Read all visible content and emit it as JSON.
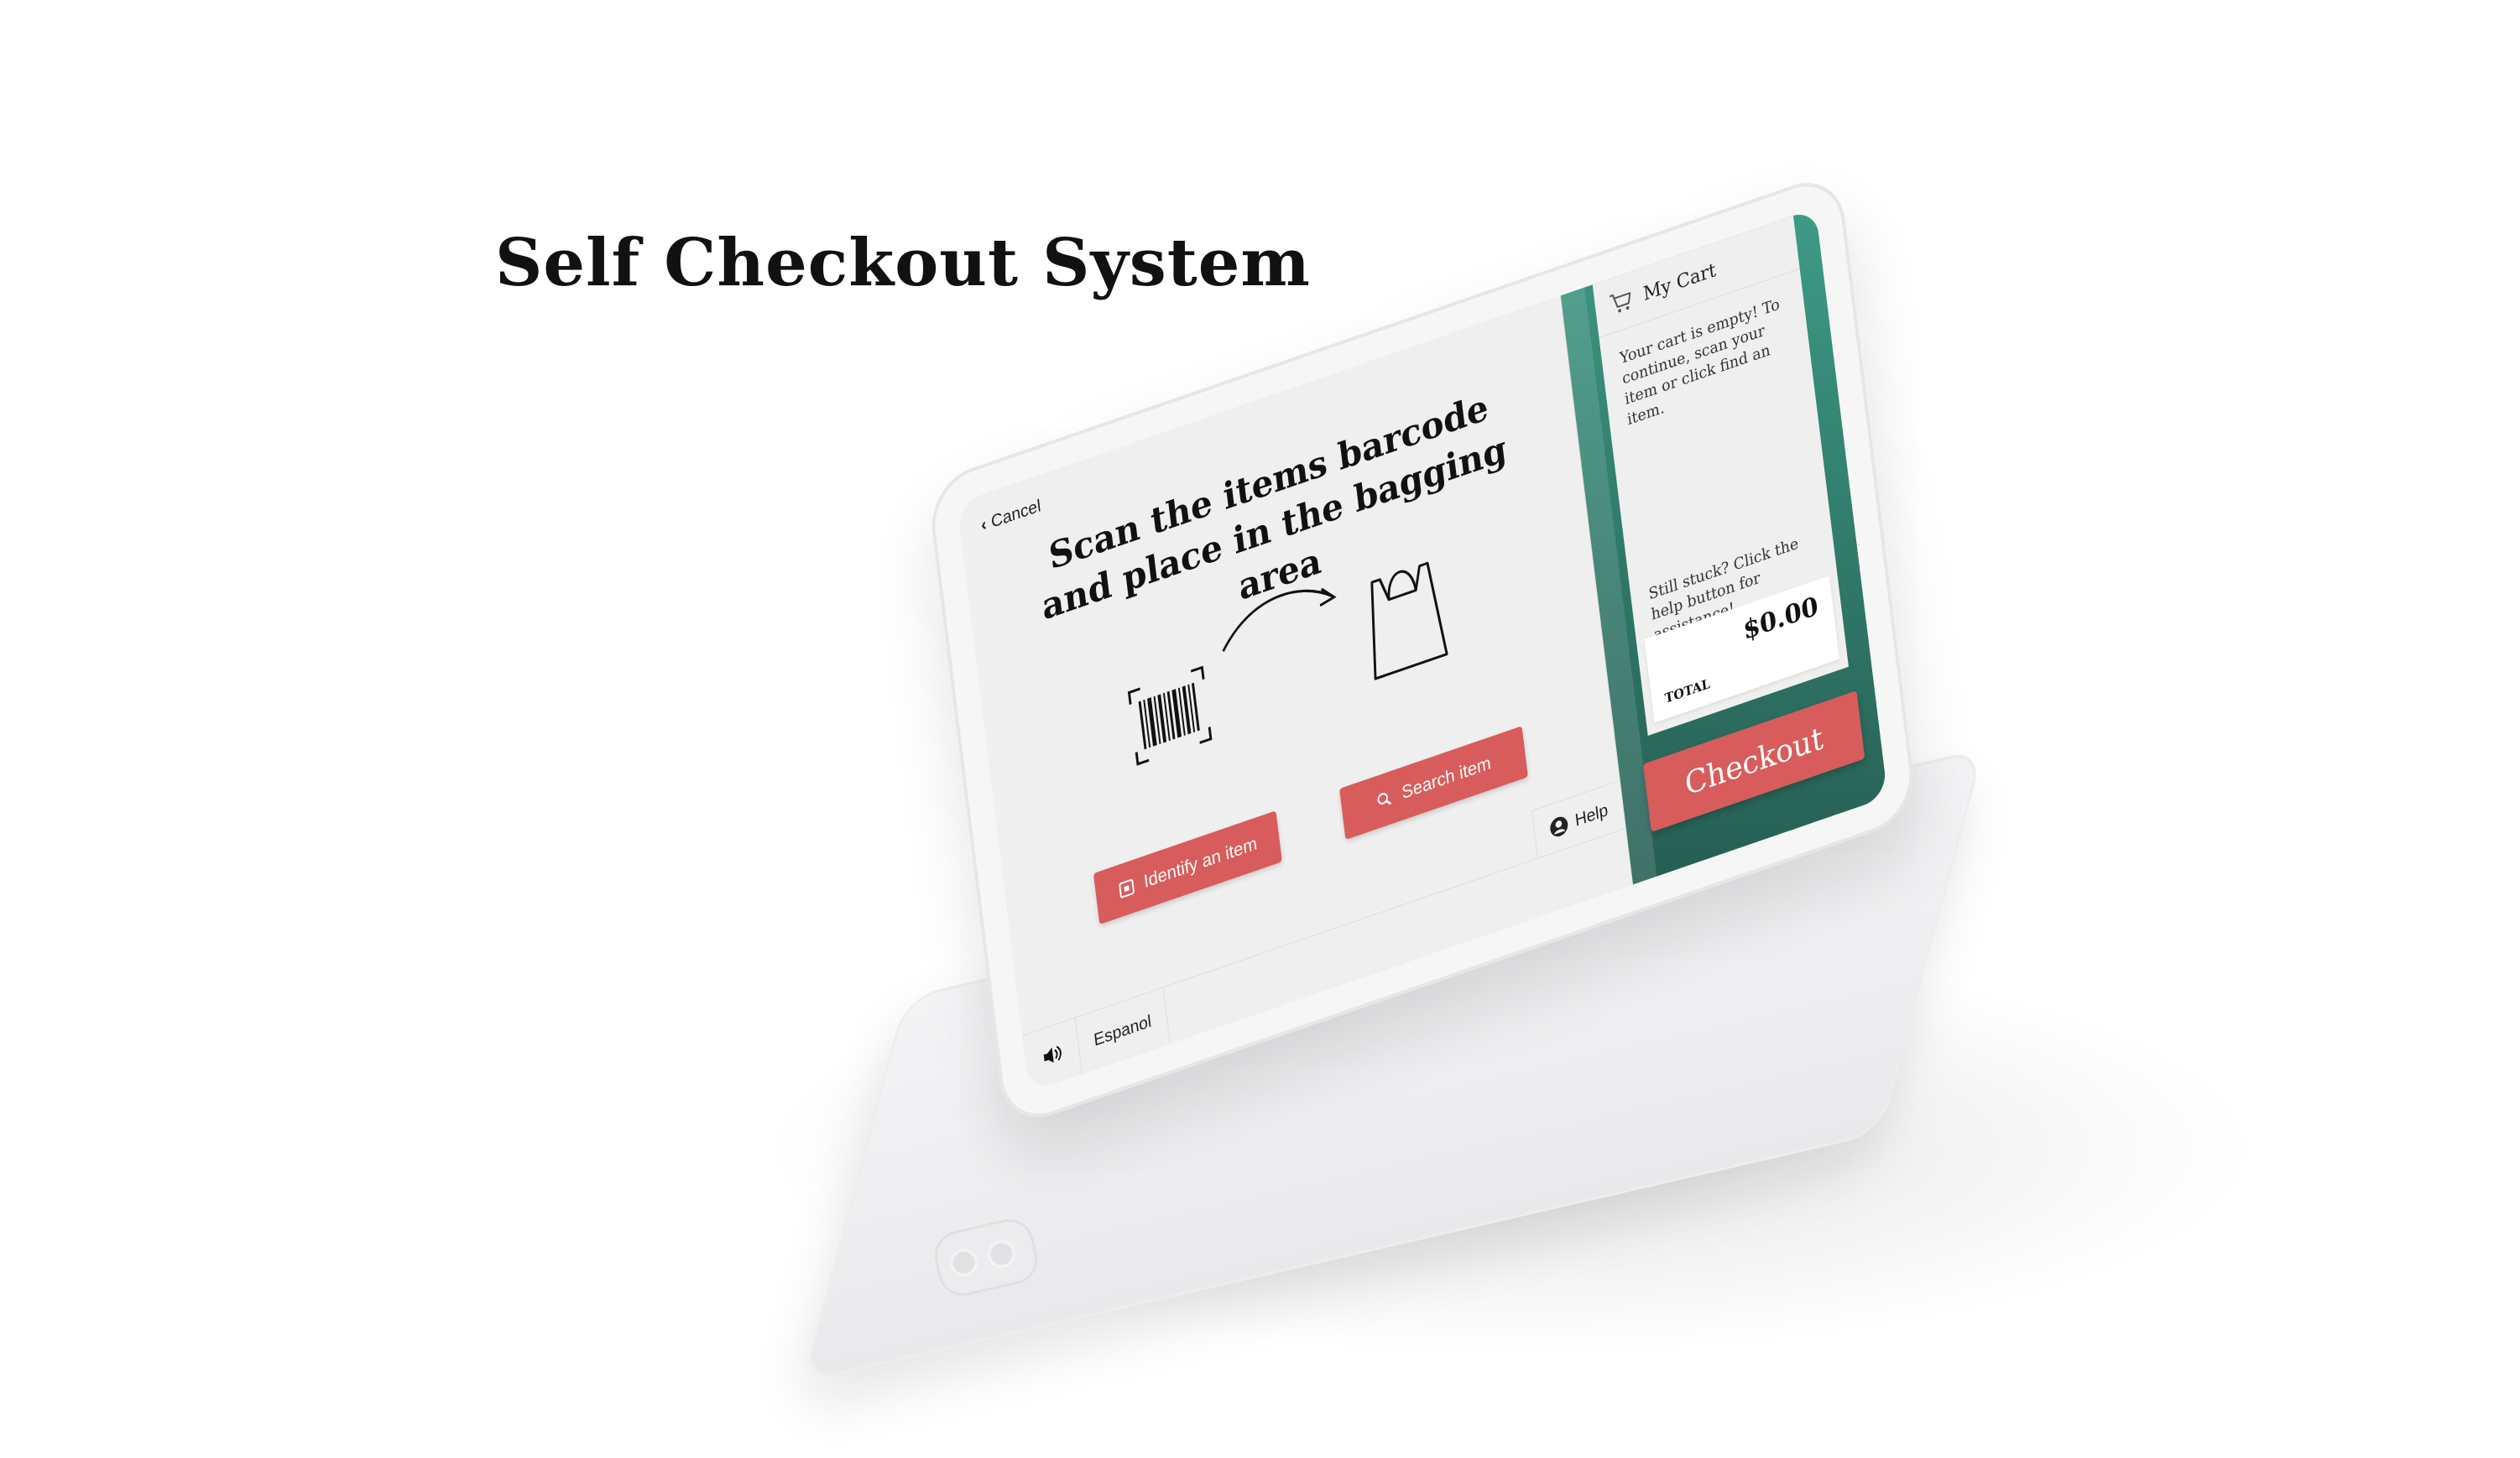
{
  "page": {
    "title": "Self Checkout System"
  },
  "scan": {
    "cancel_label": "Cancel",
    "heading_line1": "Scan the items barcode",
    "heading_line2": "and place in the bagging area",
    "identify_label": "Identify an item",
    "search_label": "Search item",
    "help_label": "Help",
    "language_label": "Espanol"
  },
  "cart": {
    "title": "My Cart",
    "empty_message": "Your cart is empty! To continue, scan your item or click find an item.",
    "stuck_message": "Still stuck? Click the help button for assistance!",
    "total_label": "TOTAL",
    "total_value": "$0.00",
    "checkout_label": "Checkout"
  },
  "icons": {
    "cancel": "chevron-left-icon",
    "cart": "cart-icon",
    "barcode": "barcode-icon",
    "arrow": "curved-arrow-icon",
    "bag": "shopping-bag-icon",
    "identify": "identify-icon",
    "search": "search-icon",
    "help": "user-circle-icon",
    "audio": "speaker-icon"
  },
  "colors": {
    "accent_red": "#d85c5c",
    "green_dark": "#265e53",
    "green_light": "#3e9b86",
    "screen_bg": "#efefef"
  }
}
